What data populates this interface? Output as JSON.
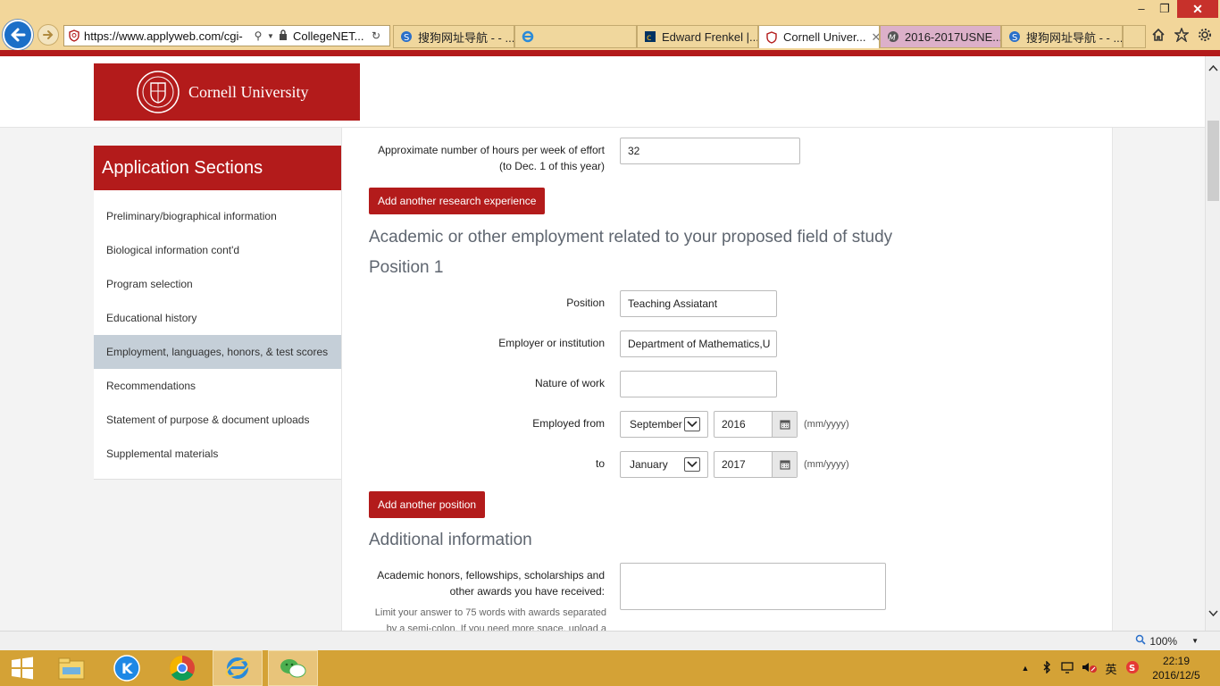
{
  "browser": {
    "url_text": "https://www.applyweb.com/cgi-",
    "url_host_highlight": "applyweb.com",
    "site_identity": "CollegeNET...",
    "tabs": [
      {
        "label": "搜狗网址导航 - - ..."
      },
      {
        "label": ""
      },
      {
        "label": "Edward Frenkel |..."
      },
      {
        "label": "Cornell Univer..."
      },
      {
        "label": "2016-2017USNE..."
      },
      {
        "label": "搜狗网址导航 - - ..."
      }
    ],
    "zoom": "100%",
    "accent_color": "#b31b1b"
  },
  "header": {
    "university_name": "Cornell University"
  },
  "sidebar": {
    "title": "Application Sections",
    "items": [
      {
        "label": "Preliminary/biographical information"
      },
      {
        "label": "Biological information cont'd"
      },
      {
        "label": "Program selection"
      },
      {
        "label": "Educational history"
      },
      {
        "label": "Employment, languages, honors, & test scores",
        "active": true
      },
      {
        "label": "Recommendations"
      },
      {
        "label": "Statement of purpose & document uploads"
      },
      {
        "label": "Supplemental materials"
      }
    ]
  },
  "research": {
    "hours_label_line1": "Approximate number of hours per week of effort",
    "hours_label_line2": "(to Dec. 1 of this year)",
    "hours_value": "32",
    "add_button": "Add another research experience"
  },
  "employment": {
    "section_title": "Academic or other employment related to your proposed field of study",
    "position_title": "Position 1",
    "position_label": "Position",
    "position_value": "Teaching Assiatant",
    "employer_label": "Employer or institution",
    "employer_value": "Department of Mathematics,U",
    "nature_label": "Nature of work",
    "nature_value": "",
    "from_label": "Employed from",
    "from_month": "September",
    "from_year": "2016",
    "to_label": "to",
    "to_month": "January",
    "to_year": "2017",
    "date_format": "(mm/yyyy)",
    "add_button": "Add another position"
  },
  "additional": {
    "section_title": "Additional information",
    "honors_label_line1": "Academic honors, fellowships, scholarships and",
    "honors_label_line2": "other awards you have received:",
    "honors_value": "",
    "hint_line1": "Limit your answer to 75 words with awards separated",
    "hint_line2": "by a semi-colon. If you need more space, upload a"
  },
  "taskbar": {
    "ime_label": "英",
    "time": "22:19",
    "date": "2016/12/5"
  }
}
